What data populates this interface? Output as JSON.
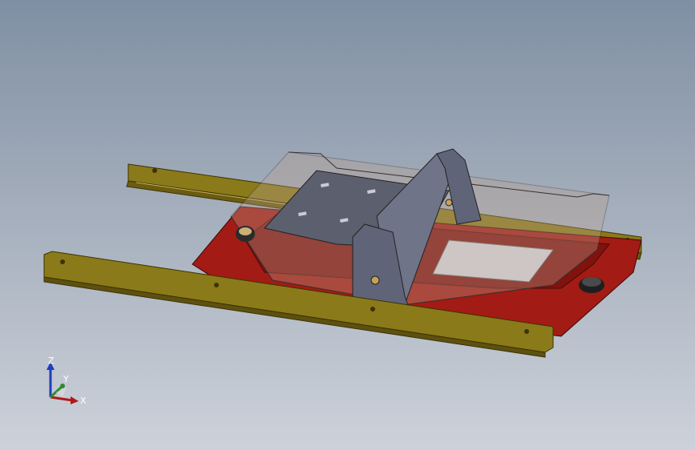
{
  "triad": {
    "x_label": "X",
    "y_label": "Y",
    "z_label": "Z"
  },
  "colors": {
    "background_top": "#7f8fa3",
    "background_bottom": "#cdd2da",
    "rail": "#8a7a1a",
    "plate": "#a21b14",
    "bracket": "#5f6478",
    "tray_edge": "#3a3030"
  }
}
